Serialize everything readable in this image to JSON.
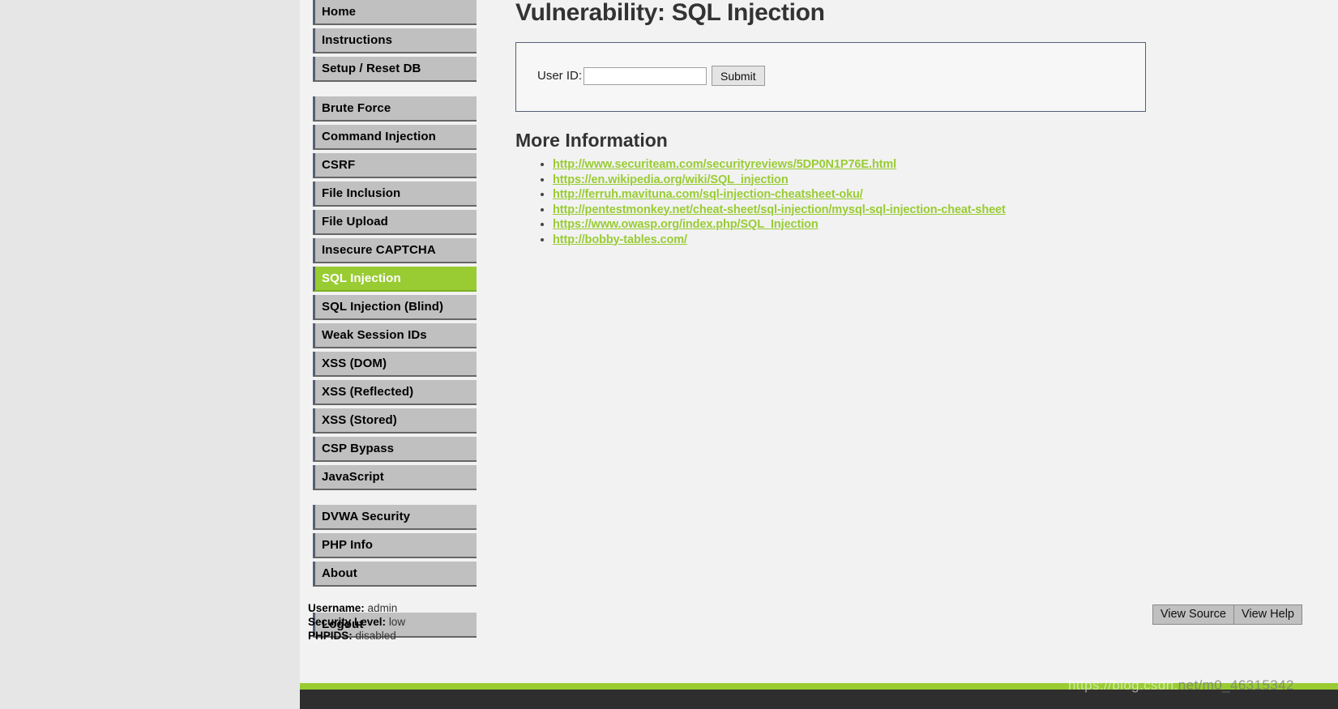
{
  "page": {
    "title": "Vulnerability: SQL Injection",
    "more_information_heading": "More Information",
    "accent_green": "#9c3",
    "menu_background": "#c0c0c0"
  },
  "sidebar": {
    "groups": [
      {
        "name": "primary",
        "items": [
          {
            "label": "Home",
            "selected": false
          },
          {
            "label": "Instructions",
            "selected": false
          },
          {
            "label": "Setup / Reset DB",
            "selected": false
          }
        ]
      },
      {
        "name": "vulnerabilities",
        "items": [
          {
            "label": "Brute Force",
            "selected": false
          },
          {
            "label": "Command Injection",
            "selected": false
          },
          {
            "label": "CSRF",
            "selected": false
          },
          {
            "label": "File Inclusion",
            "selected": false
          },
          {
            "label": "File Upload",
            "selected": false
          },
          {
            "label": "Insecure CAPTCHA",
            "selected": false
          },
          {
            "label": "SQL Injection",
            "selected": true
          },
          {
            "label": "SQL Injection (Blind)",
            "selected": false
          },
          {
            "label": "Weak Session IDs",
            "selected": false
          },
          {
            "label": "XSS (DOM)",
            "selected": false
          },
          {
            "label": "XSS (Reflected)",
            "selected": false
          },
          {
            "label": "XSS (Stored)",
            "selected": false
          },
          {
            "label": "CSP Bypass",
            "selected": false
          },
          {
            "label": "JavaScript",
            "selected": false
          }
        ]
      },
      {
        "name": "meta",
        "items": [
          {
            "label": "DVWA Security",
            "selected": false
          },
          {
            "label": "PHP Info",
            "selected": false
          },
          {
            "label": "About",
            "selected": false
          }
        ]
      },
      {
        "name": "logout",
        "items": [
          {
            "label": "Logout",
            "selected": false
          }
        ]
      }
    ]
  },
  "form": {
    "user_id_label": "User ID:",
    "user_id_value": "",
    "user_id_placeholder": "",
    "submit_label": "Submit"
  },
  "links": [
    {
      "text": "http://www.securiteam.com/securityreviews/5DP0N1P76E.html"
    },
    {
      "text": "https://en.wikipedia.org/wiki/SQL_injection"
    },
    {
      "text": "http://ferruh.mavituna.com/sql-injection-cheatsheet-oku/"
    },
    {
      "text": "http://pentestmonkey.net/cheat-sheet/sql-injection/mysql-sql-injection-cheat-sheet"
    },
    {
      "text": "https://www.owasp.org/index.php/SQL_Injection"
    },
    {
      "text": "http://bobby-tables.com/"
    }
  ],
  "system_info": {
    "username_label": "Username:",
    "username_value": "admin",
    "security_level_label": "Security Level:",
    "security_level_value": "low",
    "phpids_label": "PHPIDS:",
    "phpids_value": "disabled"
  },
  "source_buttons": {
    "view_source": "View Source",
    "view_help": "View Help"
  },
  "watermark": {
    "prefix": "https://blog.csdn.",
    "suffix": "net/m0_46315342"
  }
}
